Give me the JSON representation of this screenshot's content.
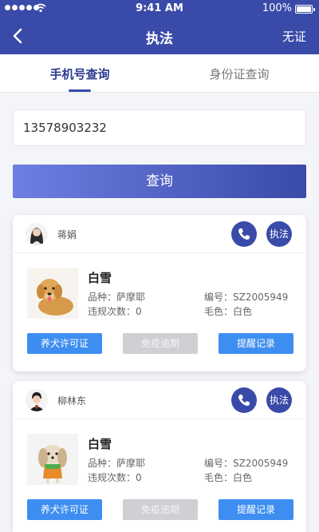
{
  "status_bar": {
    "time": "9:41 AM",
    "battery": "100%"
  },
  "nav": {
    "title": "执法",
    "right_label": "无证"
  },
  "tabs": [
    {
      "label": "手机号查询",
      "active": true
    },
    {
      "label": "身份证查询",
      "active": false
    }
  ],
  "search": {
    "value": "13578903232"
  },
  "query_button": "查询",
  "cards": [
    {
      "owner": "蒋娟",
      "call_icon": "phone-icon",
      "enforce_label": "执法",
      "pet_name": "白雪",
      "breed_label": "品种：",
      "breed": "萨摩耶",
      "id_label": "编号：",
      "id": "SZ2005949",
      "violations_label": "违规次数：",
      "violations": "0",
      "color_label": "毛色：",
      "color": "白色",
      "btn_license": "养犬许可证",
      "btn_vaccine": "免疫逾期",
      "btn_reminder": "提醒记录"
    },
    {
      "owner": "柳林东",
      "call_icon": "phone-icon",
      "enforce_label": "执法",
      "pet_name": "白雪",
      "breed_label": "品种：",
      "breed": "萨摩耶",
      "id_label": "编号：",
      "id": "SZ2005949",
      "violations_label": "违规次数：",
      "violations": "0",
      "color_label": "毛色：",
      "color": "白色",
      "btn_license": "养犬许可证",
      "btn_vaccine": "免疫逾期",
      "btn_reminder": "提醒记录"
    }
  ],
  "colors": {
    "primary": "#3a4aa8",
    "accent_blue": "#3d8ef0",
    "disabled": "#cfcfd4"
  }
}
